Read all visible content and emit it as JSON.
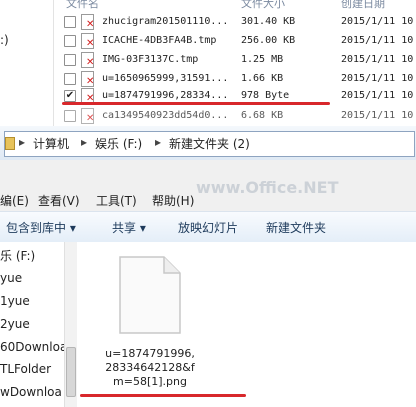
{
  "top_window": {
    "left_pane_text": ":)",
    "columns": [
      "文件名",
      "文件大小",
      "创建日期"
    ],
    "rows": [
      {
        "name": "zhucigram201501110...",
        "size": "301.40 KB",
        "date": "2015/1/11 10",
        "checked": false
      },
      {
        "name": "ICACHE-4DB3FA4B.tmp",
        "size": "256.00 KB",
        "date": "2015/1/11 10",
        "checked": false
      },
      {
        "name": "IMG-03F3137C.tmp",
        "size": "1.25 MB",
        "date": "2015/1/11 10",
        "checked": false
      },
      {
        "name": "u=1650965999,31591...",
        "size": "1.66 KB",
        "date": "2015/1/11 10",
        "checked": false
      },
      {
        "name": "u=1874791996,28334...",
        "size": "978 Byte",
        "date": "2015/1/11 10",
        "checked": true,
        "check_mark": "✔"
      },
      {
        "name": "ca1349540923dd54d0...",
        "size": "6.68 KB",
        "date": "2015/1/11 10",
        "checked": false
      }
    ]
  },
  "address_bar": {
    "crumbs": [
      "计算机",
      "娱乐 (F:)",
      "新建文件夹 (2)"
    ],
    "separator": "▸"
  },
  "menu": [
    "编(E)",
    "查看(V)",
    "工具(T)",
    "帮助(H)"
  ],
  "toolbar": [
    "包含到库中 ▾",
    "共享 ▾",
    "放映幻灯片",
    "新建文件夹"
  ],
  "watermark": "www.Office.NET",
  "nav_items": [
    "乐 (F:)",
    "yue",
    "1yue",
    "2yue",
    "60Downloa",
    "TLFolder",
    "wDownloa"
  ],
  "selected_file": {
    "label_lines": [
      "u=1874791996,",
      "28334642128&f",
      "m=58[1].png"
    ]
  },
  "colors": {
    "highlight_line": "#d8272b",
    "delete_mark": "#d21c1c"
  }
}
